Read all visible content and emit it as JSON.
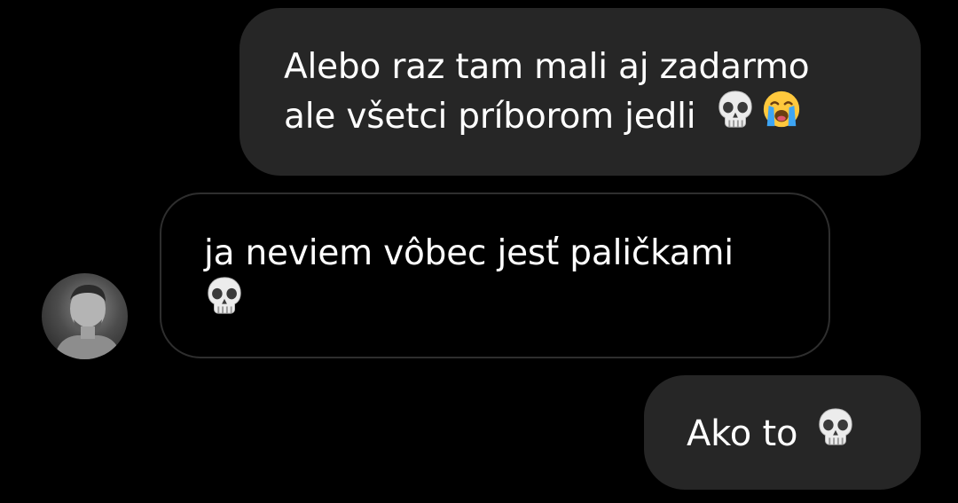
{
  "colors": {
    "background": "#000000",
    "sent_bubble": "#262626",
    "received_border": "#2e2e2e",
    "text": "#ffffff"
  },
  "messages": [
    {
      "direction": "sent",
      "lines": [
        "Alebo raz tam mali aj zadarmo",
        "ale všetci príborom jedli"
      ],
      "emojis": [
        "skull-emoji",
        "loudly-crying-face-emoji"
      ]
    },
    {
      "direction": "received",
      "lines": [
        "ja neviem vôbec jesť paličkami"
      ],
      "emojis": [
        "skull-emoji"
      ]
    },
    {
      "direction": "sent",
      "lines": [
        "Ako to"
      ],
      "emojis": [
        "skull-emoji"
      ]
    }
  ],
  "contact": {
    "avatar": "grayscale-portrait-avatar"
  }
}
